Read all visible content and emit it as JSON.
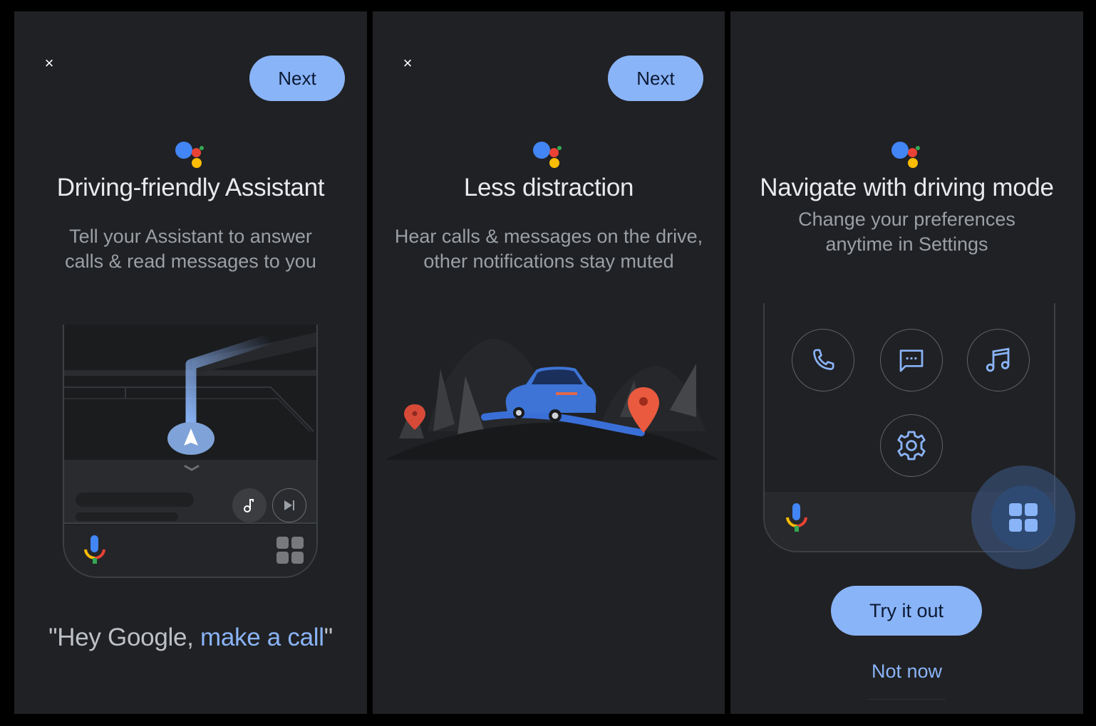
{
  "colors": {
    "background": "#000000",
    "panel": "#202124",
    "accent": "#8ab4f8",
    "title_text": "#e8eaed",
    "subtitle_text": "#9aa0a6",
    "google_blue": "#4285f4",
    "google_red": "#ea4335",
    "google_yellow": "#fbbc04",
    "google_green": "#34a853"
  },
  "panels": [
    {
      "close_icon": "close-icon",
      "close_glyph": "×",
      "next_label": "Next",
      "logo": "google-assistant-logo",
      "title": "Driving-friendly Assistant",
      "subtitle_line1": "Tell your Assistant to answer",
      "subtitle_line2": "calls & read messages to you",
      "illustration": {
        "type": "navigation-screen",
        "icons": [
          "navigation-arrow-icon",
          "chevron-down-icon",
          "music-note-icon",
          "skip-next-icon",
          "microphone-icon",
          "app-grid-icon"
        ]
      },
      "quote_prefix": "\"Hey Google, ",
      "quote_highlight": "make a call",
      "quote_suffix": "\""
    },
    {
      "close_icon": "close-icon",
      "close_glyph": "×",
      "next_label": "Next",
      "logo": "google-assistant-logo",
      "title": "Less distraction",
      "subtitle_line1": "Hear calls & messages on the drive,",
      "subtitle_line2": "other notifications stay muted",
      "illustration": {
        "type": "car-on-road",
        "icons": [
          "car-icon",
          "map-pin-icon"
        ]
      }
    },
    {
      "logo": "google-assistant-logo",
      "title": "Navigate with driving mode",
      "subtitle_line1": "Change your preferences",
      "subtitle_line2": "anytime in Settings",
      "apps": [
        {
          "name": "phone",
          "icon": "phone-icon"
        },
        {
          "name": "messages",
          "icon": "message-icon"
        },
        {
          "name": "music",
          "icon": "music-icon"
        },
        {
          "name": "settings",
          "icon": "gear-icon"
        }
      ],
      "try_label": "Try it out",
      "not_now_label": "Not now"
    }
  ]
}
